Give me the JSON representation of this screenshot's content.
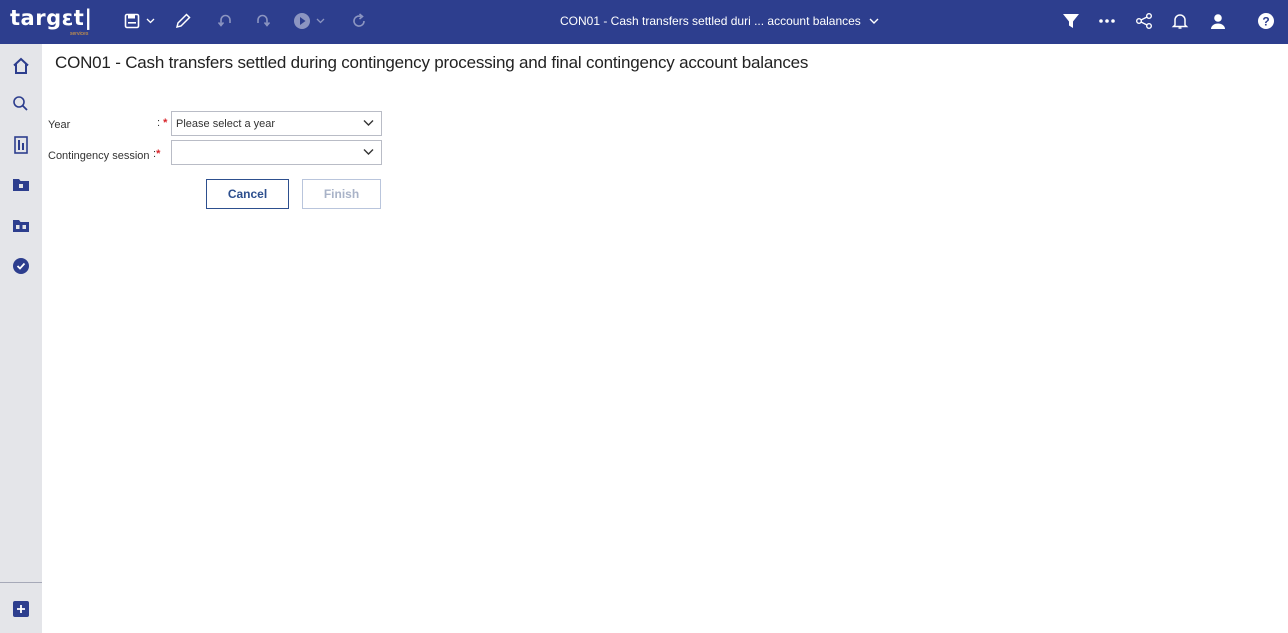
{
  "app": {
    "brand": "targεt|",
    "brand_sub": "services",
    "window_title": "CON01 - Cash transfers settled duri ... account balances"
  },
  "page": {
    "title": "CON01 - Cash transfers settled during contingency processing and final contingency account balances"
  },
  "form": {
    "year_label": "Year",
    "year_placeholder": "Please select a year",
    "session_label": "Contingency session",
    "session_value": "",
    "colon": ":",
    "required_mark": "*"
  },
  "buttons": {
    "cancel": "Cancel",
    "finish": "Finish"
  },
  "toolbar_icons": [
    "save-icon",
    "chevron-down-icon",
    "edit-pencil-icon",
    "undo-icon",
    "redo-icon",
    "run-icon",
    "chevron-down-icon",
    "refresh-icon"
  ],
  "header_icons": [
    "filter-icon",
    "more-icon",
    "share-icon",
    "bell-icon",
    "user-icon",
    "help-icon"
  ],
  "sidebar_icons": [
    "home-icon",
    "search-icon",
    "report-icon",
    "folder-icon",
    "team-folder-icon",
    "check-circle-icon",
    "add-icon"
  ],
  "colors": {
    "header_bg": "#2d3e8e",
    "sidebar_bg": "#e4e5e9",
    "required": "#d8252b",
    "button_border": "#2d4f8e"
  }
}
